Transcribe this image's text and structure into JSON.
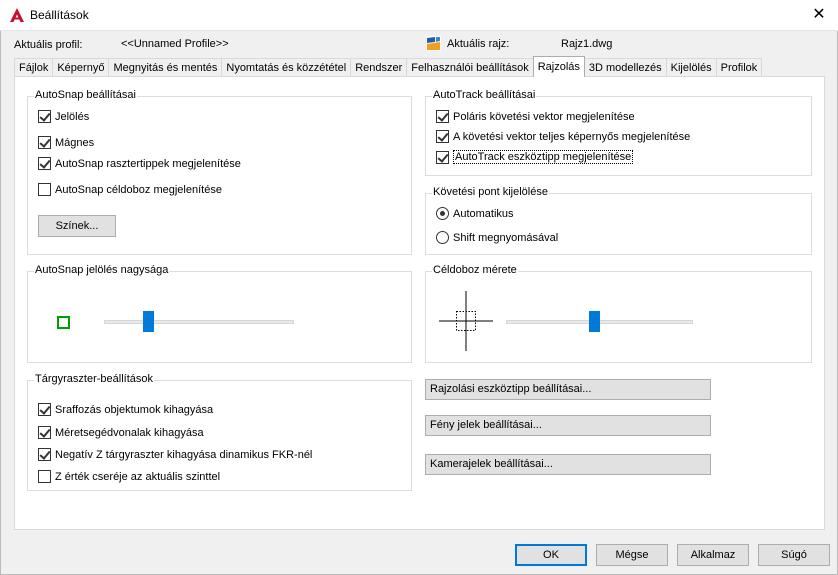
{
  "window": {
    "title": "Beállítások",
    "close_glyph": "✕"
  },
  "header": {
    "profile_label": "Aktuális profil:",
    "profile_value": "<<Unnamed Profile>>",
    "drawing_label": "Aktuális rajz:",
    "drawing_value": "Rajz1.dwg",
    "drawing_icon": "drawing-file-icon"
  },
  "tabs": [
    {
      "label": "Fájlok",
      "active": false
    },
    {
      "label": "Képernyő",
      "active": false
    },
    {
      "label": "Megnyitás és mentés",
      "active": false
    },
    {
      "label": "Nyomtatás és közzététel",
      "active": false
    },
    {
      "label": "Rendszer",
      "active": false
    },
    {
      "label": "Felhasználói beállítások",
      "active": false
    },
    {
      "label": "Rajzolás",
      "active": true
    },
    {
      "label": "3D modellezés",
      "active": false
    },
    {
      "label": "Kijelölés",
      "active": false
    },
    {
      "label": "Profilok",
      "active": false
    }
  ],
  "autosnap": {
    "title": "AutoSnap beállításai",
    "items": [
      {
        "label": "Jelölés",
        "checked": true
      },
      {
        "label": "Mágnes",
        "checked": true
      },
      {
        "label": "AutoSnap rasztertippek megjelenítése",
        "checked": true
      },
      {
        "label": "AutoSnap céldoboz megjelenítése",
        "checked": false
      }
    ],
    "colors_button": "Színek..."
  },
  "autotrack": {
    "title": "AutoTrack beállításai",
    "items": [
      {
        "label": "Poláris követési vektor megjelenítése",
        "checked": true
      },
      {
        "label": "A követési vektor teljes képernyős megjelenítése",
        "checked": true
      },
      {
        "label": "AutoTrack eszköztipp megjelenítése",
        "checked": true
      }
    ]
  },
  "tracking_point": {
    "title": "Követési pont kijelölése",
    "options": [
      {
        "label": "Automatikus",
        "checked": true
      },
      {
        "label": "Shift megnyomásával",
        "checked": false
      }
    ]
  },
  "marker_size": {
    "title": "AutoSnap jelölés nagysága",
    "preview_color": "#00a000",
    "slider_value": 0.22
  },
  "aperture_size": {
    "title": "Céldoboz mérete",
    "slider_value": 0.47
  },
  "object_snap": {
    "title": "Tárgyraszter-beállítások",
    "items": [
      {
        "label": "Sraffozás objektumok kihagyása",
        "checked": true
      },
      {
        "label": "Méretsegédvonalak kihagyása",
        "checked": true
      },
      {
        "label": "Negatív Z tárgyraszter kihagyása dinamikus FKR-nél",
        "checked": true
      },
      {
        "label": "Z érték cseréje az aktuális szinttel",
        "checked": false
      }
    ]
  },
  "side_buttons": {
    "drafting_tooltip": "Rajzolási eszköztipp beállításai...",
    "lights_glyph": "Fény jelek beállításai...",
    "camera_glyph": "Kamerajelek beállításai..."
  },
  "footer": {
    "ok": "OK",
    "cancel": "Mégse",
    "apply": "Alkalmaz",
    "help": "Súgó"
  },
  "colors": {
    "accent": "#0078d7",
    "slider_thumb": "#007ad9",
    "app_icon": "#c8102e"
  }
}
